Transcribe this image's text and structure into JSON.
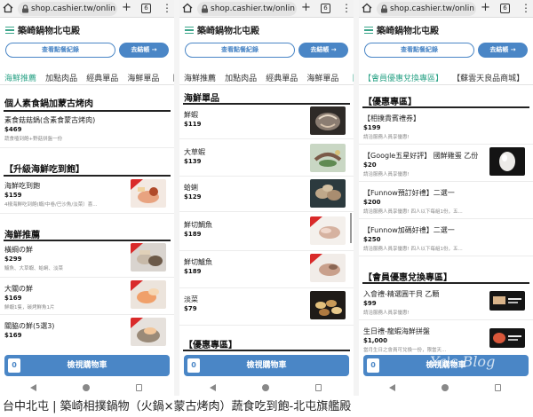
{
  "browser": {
    "url": "shop.cashier.tw/online",
    "tab_count": "6"
  },
  "app": {
    "store_name": "築崎鍋物北屯殿",
    "order_record_label": "查看點餐紀錄",
    "checkout_label": "去結帳 →",
    "cart_count": "0",
    "cart_label": "檢視購物車"
  },
  "panel1": {
    "categories": [
      {
        "label": "海鮮推薦",
        "active": true
      },
      {
        "label": "加點肉品"
      },
      {
        "label": "經典單品"
      },
      {
        "label": "海鮮單品"
      },
      {
        "label": "【"
      }
    ],
    "section_a": "個人素食鍋加蒙古烤肉",
    "item_a": {
      "name": "素食菇菇鍋(含素食蒙古烤肉)",
      "price": "$469",
      "desc": "蔬食嗑到飽+野菇拼盤一份"
    },
    "section_b": "【升級海鮮吃到飽】",
    "item_b": {
      "name": "海鮮吃到飽",
      "price": "$159",
      "desc": "4樣海鮮吃到飽(蝦/中卷/巴沙魚/淡菜）喜..."
    },
    "section_c": "海鮮推薦",
    "items_c": [
      {
        "name": "橫綱の鮮",
        "price": "$299",
        "desc": "鱸魚、大草蝦、蛤蜊、淡菜"
      },
      {
        "name": "大關の鮮",
        "price": "$169",
        "desc": "鮮蝦1隻，碳烤鮮魚1片"
      },
      {
        "name": "關脇の鮮(5選3)",
        "price": "$169",
        "desc": ""
      }
    ]
  },
  "panel2": {
    "categories": [
      {
        "label": "海鮮推薦"
      },
      {
        "label": "加點肉品"
      },
      {
        "label": "經典單品"
      },
      {
        "label": "海鮮單品"
      },
      {
        "label": "【"
      }
    ],
    "section_a": "海鮮單品",
    "items": [
      {
        "name": "鮮蝦",
        "price": "$119"
      },
      {
        "name": "大草蝦",
        "price": "$139"
      },
      {
        "name": "蛤蜊",
        "price": "$129"
      },
      {
        "name": "鮮切鯛魚",
        "price": "$189"
      },
      {
        "name": "鮮切鱸魚",
        "price": "$189"
      },
      {
        "name": "淡菜",
        "price": "$79"
      }
    ],
    "section_b": "【優惠專區】"
  },
  "panel3": {
    "categories": [
      {
        "label": "【會員優惠兌換專區】",
        "active": true
      },
      {
        "label": "【蘇雲天良品商城】"
      }
    ],
    "section_a": "【優惠專區】",
    "items_a": [
      {
        "name": "【相撲貴賓禮券】",
        "price": "$199",
        "desc": "請洽服務人員享優惠!"
      },
      {
        "name": "【Google五星好評】 國鮮雞蛋 乙份",
        "price": "$20",
        "desc": "請洽服務人員享優惠!"
      },
      {
        "name": "【Funnow預訂好禮】二選一",
        "price": "$200",
        "desc": "請洽服務人員享優惠! 四人以下每組1份，五..."
      },
      {
        "name": "【Funnow加碼好禮】二選一",
        "price": "$250",
        "desc": "請洽服務人員享優惠! 四人以下每組1份，五..."
      }
    ],
    "section_b": "【會員優惠兌換專區】",
    "items_b": [
      {
        "name": "入會禮-精選圓干貝 乙顆",
        "price": "$99",
        "desc": "請洽服務人員享優惠!"
      },
      {
        "name": "生日禮-龍蝦海鮮拼盤",
        "price": "$1,000",
        "desc": "當月生日之會員可兌換一份，限當天..."
      }
    ]
  },
  "watermark": "Ya's Blog",
  "caption": "台中北屯 | 築崎相撲鍋物（火鍋×蒙古烤肉）蔬食吃到飽-北屯旗艦殿"
}
